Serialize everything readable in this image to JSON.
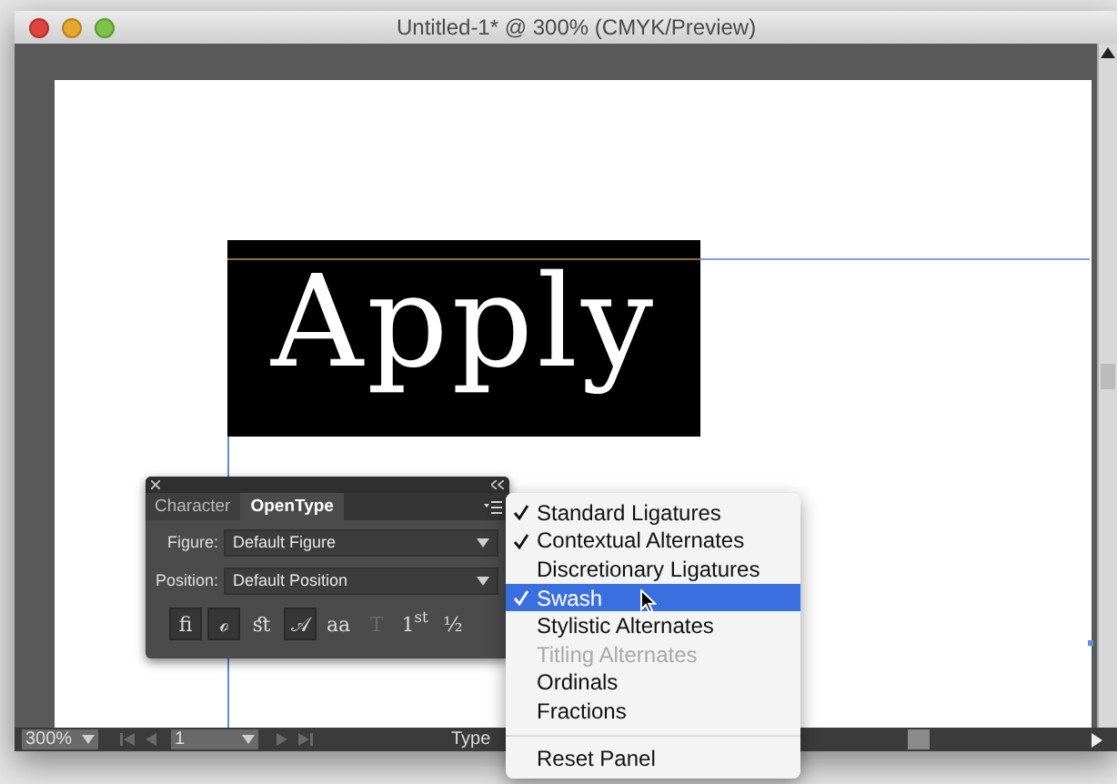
{
  "window": {
    "title": "Untitled-1* @ 300% (CMYK/Preview)"
  },
  "artboard": {
    "text": "Apply"
  },
  "panel": {
    "tabs": [
      {
        "label": "Character",
        "selected": false
      },
      {
        "label": "OpenType",
        "selected": true
      }
    ],
    "fields": [
      {
        "label": "Figure:",
        "value": "Default Figure"
      },
      {
        "label": "Position:",
        "value": "Default Position"
      }
    ],
    "glyph_buttons": [
      {
        "label": "fi",
        "selected": true,
        "disabled": false
      },
      {
        "label": "ℴ",
        "selected": true,
        "disabled": false
      },
      {
        "label": "ﬆ",
        "selected": false,
        "disabled": false
      },
      {
        "label": "𝒜",
        "selected": true,
        "disabled": false
      },
      {
        "label": "aa",
        "selected": false,
        "disabled": false
      },
      {
        "label": "T",
        "selected": false,
        "disabled": true
      },
      {
        "label": "1$^{st}$",
        "selected": false,
        "disabled": false
      },
      {
        "label": "½",
        "selected": false,
        "disabled": false
      }
    ]
  },
  "menu": {
    "items": [
      {
        "label": "Standard Ligatures",
        "checked": true,
        "selected": false,
        "disabled": false
      },
      {
        "label": "Contextual Alternates",
        "checked": true,
        "selected": false,
        "disabled": false
      },
      {
        "label": "Discretionary Ligatures",
        "checked": false,
        "selected": false,
        "disabled": false
      },
      {
        "label": "Swash",
        "checked": true,
        "selected": true,
        "disabled": false
      },
      {
        "label": "Stylistic Alternates",
        "checked": false,
        "selected": false,
        "disabled": false
      },
      {
        "label": "Titling Alternates",
        "checked": false,
        "selected": false,
        "disabled": true
      },
      {
        "label": "Ordinals",
        "checked": false,
        "selected": false,
        "disabled": false
      },
      {
        "label": "Fractions",
        "checked": false,
        "selected": false,
        "disabled": false
      }
    ],
    "footer": "Reset Panel"
  },
  "status_bar": {
    "zoom": "300%",
    "page": "1",
    "tool": "Type"
  }
}
